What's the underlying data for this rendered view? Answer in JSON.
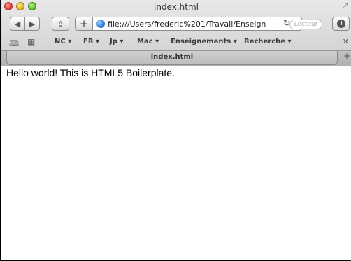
{
  "window": {
    "title": "index.html"
  },
  "toolbar": {
    "back_icon": "◀",
    "forward_icon": "▶",
    "share_icon": "⇪",
    "add_icon": "+",
    "url": "file:///Users/frederic%201/Travail/Enseign",
    "reload_icon": "↻",
    "reader_label": "Lecteur",
    "downloads_icon": "⬇"
  },
  "bookmarks": {
    "items": [
      {
        "label": "NC ▾"
      },
      {
        "label": "FR ▾"
      },
      {
        "label": "Jp ▾"
      },
      {
        "label": "Mac ▾"
      },
      {
        "label": "Enseignements ▾"
      },
      {
        "label": "Recherche ▾"
      }
    ],
    "close_icon": "✕"
  },
  "tabs": {
    "active_label": "index.html",
    "new_tab_icon": "+"
  },
  "page": {
    "text": "Hello world! This is HTML5 Boilerplate."
  }
}
